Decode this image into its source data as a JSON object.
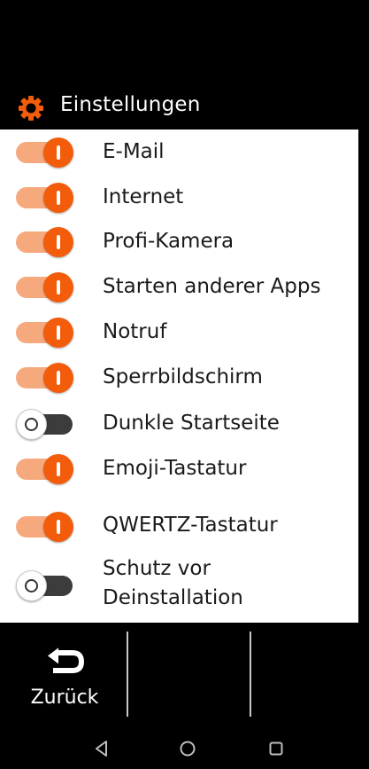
{
  "header": {
    "title": "Einstellungen",
    "icon": "gear-icon",
    "accent_color": "#f25c0a"
  },
  "settings": [
    {
      "label": "E-Mail",
      "enabled": true
    },
    {
      "label": "Internet",
      "enabled": true
    },
    {
      "label": "Profi-Kamera",
      "enabled": true
    },
    {
      "label": "Starten anderer Apps",
      "enabled": true
    },
    {
      "label": "Notruf",
      "enabled": true
    },
    {
      "label": "Sperrbildschirm",
      "enabled": true
    },
    {
      "label": "Dunkle Startseite",
      "enabled": false
    },
    {
      "label": "Emoji-Tastatur",
      "enabled": true
    },
    {
      "label": "QWERTZ-Tastatur",
      "enabled": true
    },
    {
      "label_line1": "Schutz vor",
      "label_line2": "Deinstallation",
      "enabled": false
    }
  ],
  "footer": {
    "back_label": "Zurück",
    "back_icon": "return-arrow-icon"
  },
  "navbar": {
    "back_icon": "triangle-back-icon",
    "home_icon": "circle-home-icon",
    "recents_icon": "square-recents-icon"
  }
}
